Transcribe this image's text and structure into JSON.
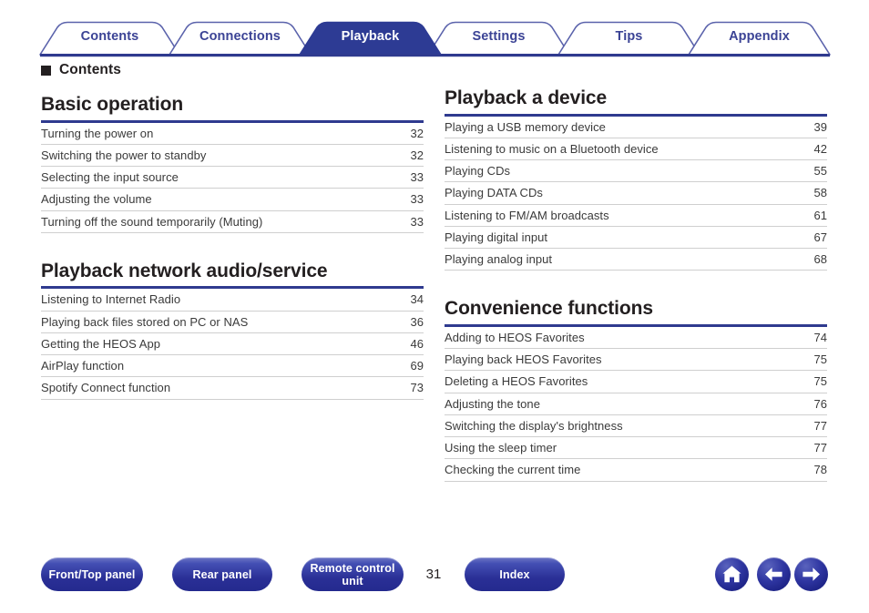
{
  "theme": {
    "navy": "#2f3a8f",
    "tab_active_fill": "#2d3b94",
    "tab_inactive_text": "#3b4395",
    "rule_gray": "#cfcfcf",
    "text": "#231f20",
    "button_blue": "#2a2f96"
  },
  "tabs": [
    {
      "label": "Contents",
      "active": false
    },
    {
      "label": "Connections",
      "active": false
    },
    {
      "label": "Playback",
      "active": true
    },
    {
      "label": "Settings",
      "active": false
    },
    {
      "label": "Tips",
      "active": false
    },
    {
      "label": "Appendix",
      "active": false
    }
  ],
  "header": {
    "bullet_icon": "black-square-icon",
    "title": "Contents"
  },
  "columns": {
    "left": [
      {
        "title": "Basic operation",
        "items": [
          {
            "title": "Turning the power on",
            "page": "32"
          },
          {
            "title": "Switching the power to standby",
            "page": "32"
          },
          {
            "title": "Selecting the input source",
            "page": "33"
          },
          {
            "title": "Adjusting the volume",
            "page": "33"
          },
          {
            "title": "Turning off the sound temporarily (Muting)",
            "page": "33"
          }
        ]
      },
      {
        "title": "Playback network audio/service",
        "items": [
          {
            "title": "Listening to Internet Radio",
            "page": "34"
          },
          {
            "title": "Playing back files stored on PC or NAS",
            "page": "36"
          },
          {
            "title": "Getting the HEOS App",
            "page": "46"
          },
          {
            "title": "AirPlay function",
            "page": "69"
          },
          {
            "title": "Spotify Connect function",
            "page": "73"
          }
        ]
      }
    ],
    "right": [
      {
        "title": "Playback a device",
        "items": [
          {
            "title": "Playing a USB memory device",
            "page": "39"
          },
          {
            "title": "Listening to music on a Bluetooth device",
            "page": "42"
          },
          {
            "title": "Playing CDs",
            "page": "55"
          },
          {
            "title": "Playing DATA CDs",
            "page": "58"
          },
          {
            "title": "Listening to FM/AM broadcasts",
            "page": "61"
          },
          {
            "title": "Playing digital input",
            "page": "67"
          },
          {
            "title": "Playing analog input",
            "page": "68"
          }
        ]
      },
      {
        "title": "Convenience functions",
        "items": [
          {
            "title": "Adding to HEOS Favorites",
            "page": "74"
          },
          {
            "title": "Playing back HEOS Favorites",
            "page": "75"
          },
          {
            "title": "Deleting a HEOS Favorites",
            "page": "75"
          },
          {
            "title": "Adjusting the tone",
            "page": "76"
          },
          {
            "title": "Switching the display's brightness",
            "page": "77"
          },
          {
            "title": "Using the sleep timer",
            "page": "77"
          },
          {
            "title": "Checking the current time",
            "page": "78"
          }
        ]
      }
    ]
  },
  "footer": {
    "buttons": [
      {
        "label": "Front/Top panel"
      },
      {
        "label": "Rear panel"
      },
      {
        "label": "Remote control unit"
      },
      {
        "label": "Index"
      }
    ],
    "page_number": "31",
    "nav_icons": [
      {
        "name": "home-icon"
      },
      {
        "name": "arrow-left-icon"
      },
      {
        "name": "arrow-right-icon"
      }
    ]
  }
}
